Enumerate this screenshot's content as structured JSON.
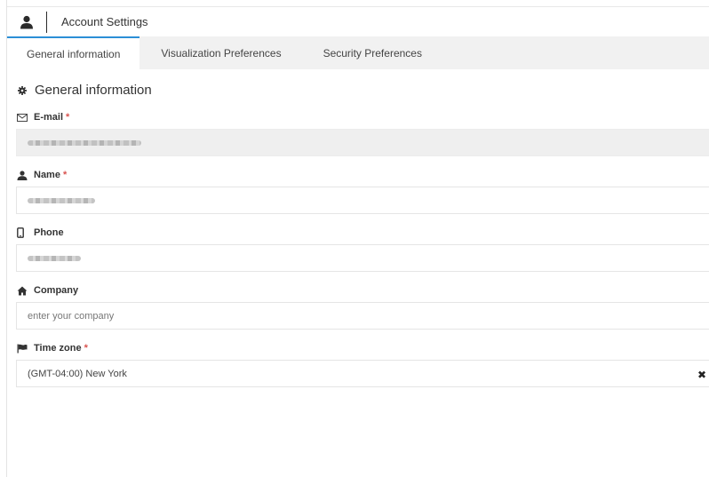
{
  "header": {
    "title": "Account Settings",
    "icon": "user-icon"
  },
  "tabs": [
    {
      "label": "General information",
      "active": true
    },
    {
      "label": "Visualization Preferences",
      "active": false
    },
    {
      "label": "Security Preferences",
      "active": false
    }
  ],
  "section": {
    "title": "General information",
    "icon": "gear-icon"
  },
  "fields": {
    "email": {
      "label": "E-mail",
      "required_mark": "*",
      "icon": "envelope-icon",
      "value_state": "redacted",
      "disabled": true
    },
    "name": {
      "label": "Name",
      "required_mark": "*",
      "icon": "user-icon",
      "value_state": "redacted"
    },
    "phone": {
      "label": "Phone",
      "icon": "mobile-phone-icon",
      "value_state": "redacted"
    },
    "company": {
      "label": "Company",
      "icon": "home-icon",
      "placeholder": "enter your company",
      "value": ""
    },
    "timezone": {
      "label": "Time zone",
      "required_mark": "*",
      "icon": "flag-icon",
      "value": "(GMT-04:00) New York",
      "clear_label": "✖"
    }
  },
  "colors": {
    "tab_accent": "#2b8fd6",
    "required": "#d9534f",
    "tabs_bg": "#f1f1f1",
    "disabled_input_bg": "#efefef"
  }
}
